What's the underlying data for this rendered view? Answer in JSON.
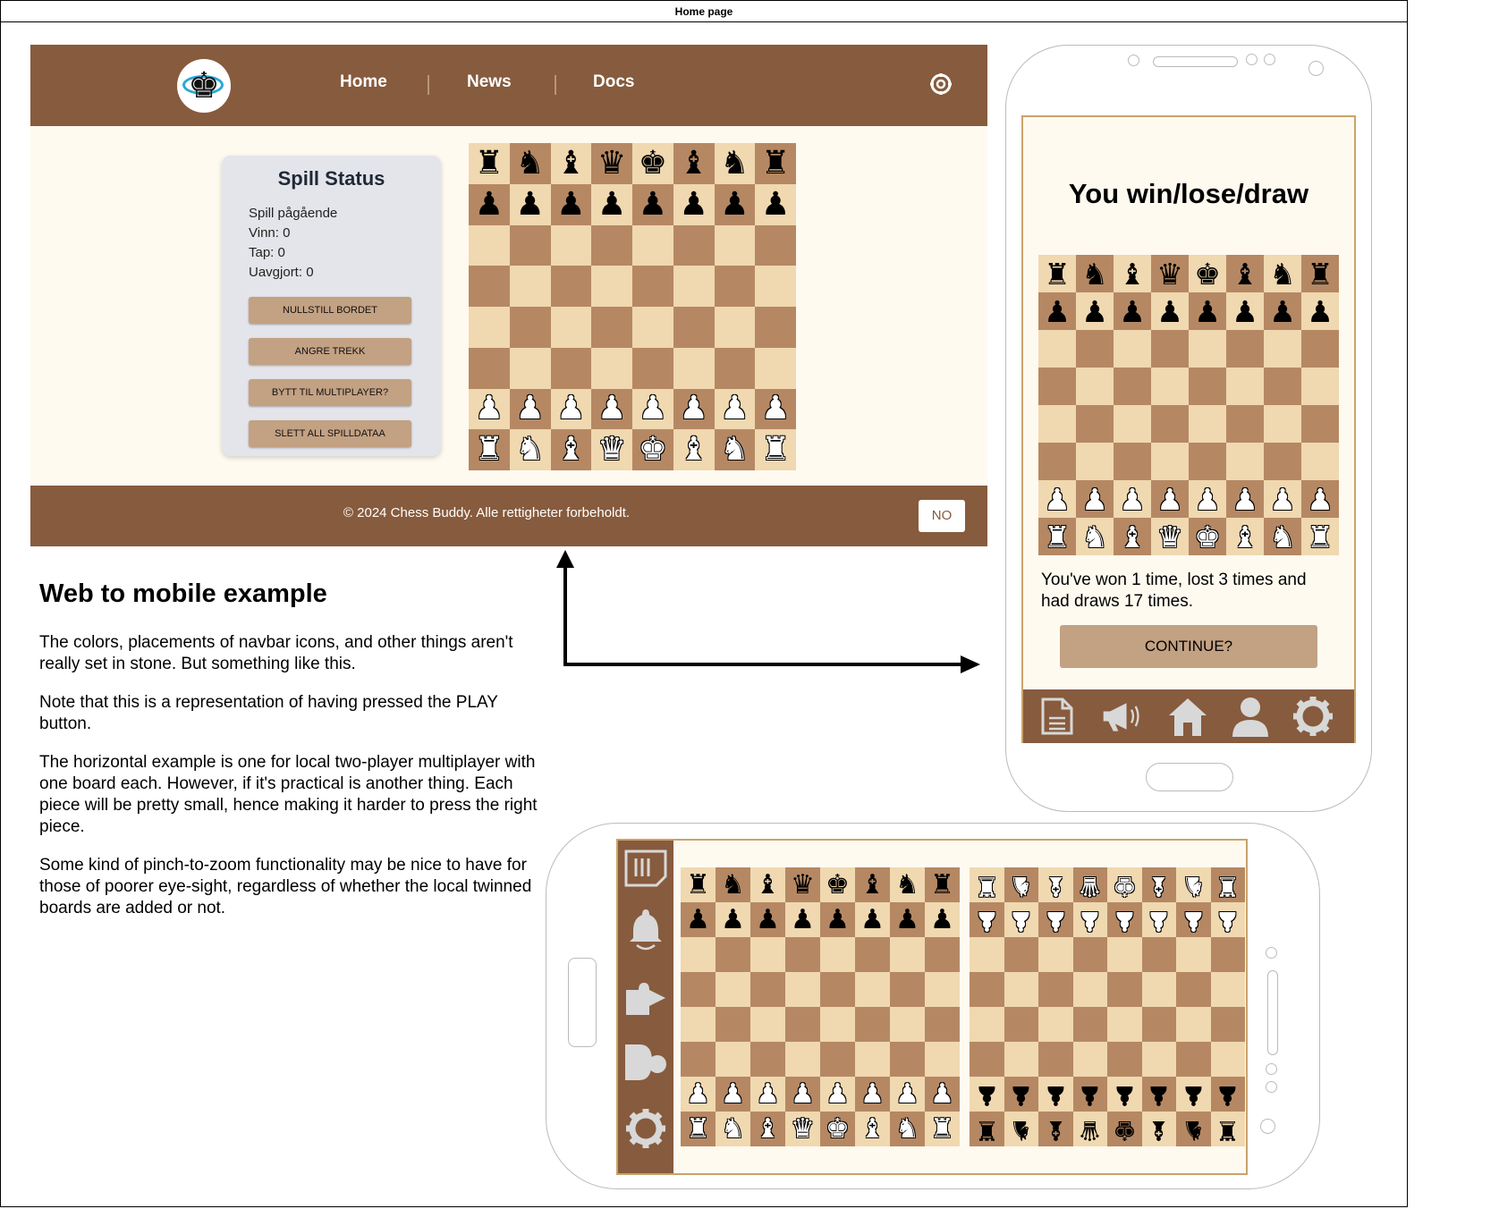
{
  "page_title": "Home page",
  "web": {
    "nav": {
      "home": "Home",
      "news": "News",
      "docs": "Docs"
    },
    "status": {
      "title": "Spill Status",
      "state": "Spill pågående",
      "wins": "Vinn: 0",
      "losses": "Tap: 0",
      "draws": "Uavgjort: 0",
      "buttons": [
        "NULLSTILL BORDET",
        "ANGRE TREKK",
        "BYTT TIL MULTIPLAYER?",
        "SLETT ALL SPILLDATAA"
      ]
    },
    "footer": {
      "copyright": "© 2024 Chess Buddy. Alle rettigheter forbeholdt.",
      "language": "NO"
    }
  },
  "notes": {
    "heading": "Web to mobile example",
    "paragraphs": [
      "The colors, placements of navbar icons, and other things aren't really set in stone. But something like this.",
      "Note that this is a representation of having pressed the PLAY button.",
      "The horizontal example is one for local two-player multiplayer with one board each. However, if it's practical is another thing. Each piece will be pretty small, hence making it harder to press the right piece.",
      "Some kind of pinch-to-zoom functionality may be nice to have for those of poorer eye-sight, regardless of whether the local twinned boards are added or not."
    ]
  },
  "mobile": {
    "result_title": "You win/lose/draw",
    "result_text": "You've won 1 time, lost 3 times and had draws 17 times.",
    "continue_label": "CONTINUE?",
    "tabs": [
      "document-icon",
      "megaphone-icon",
      "home-icon",
      "user-icon",
      "gear-icon"
    ]
  },
  "landscape": {
    "sidebar": [
      "document-icon",
      "bell-icon",
      "arrow-icon",
      "pieces-icon",
      "gear-icon"
    ]
  },
  "board": {
    "ranks": [
      "rnbqkbnr",
      "pppppppp",
      "........",
      "........",
      "........",
      "........",
      "PPPPPPPP",
      "RNBQKBNR"
    ]
  },
  "colors": {
    "brown": "#875b3d",
    "cream": "#fffaf0",
    "button": "#c3a183",
    "light_square": "#f0d8b0",
    "dark_square": "#b58863"
  }
}
